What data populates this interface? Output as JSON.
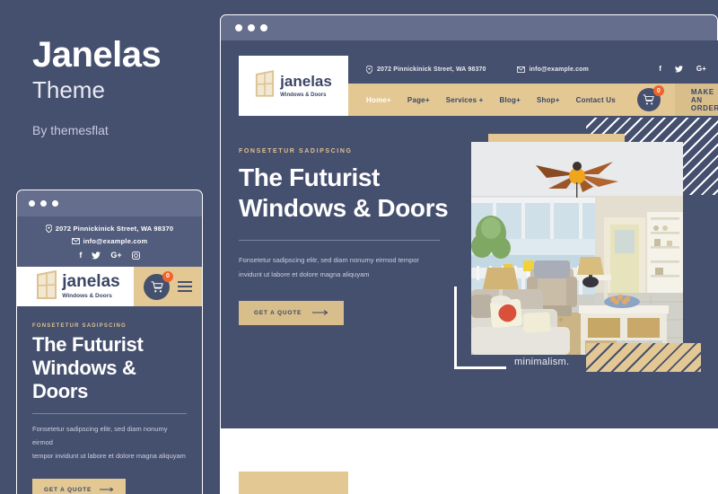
{
  "theme": {
    "name": "Janelas",
    "kind": "Theme",
    "author": "By themesflat",
    "colors": {
      "background": "#454f6e",
      "accent_tan": "#e3c894",
      "chrome": "#656e8c",
      "badge_orange": "#f0632a",
      "text_light": "#ccd1e0"
    }
  },
  "chrome": {
    "dots": [
      "red",
      "yellow",
      "green"
    ]
  },
  "site": {
    "logo": {
      "name": "janelas",
      "tagline": "Windows & Doors",
      "icon": "open-door-window-icon"
    },
    "topbar": {
      "address": "2072 Pinnickinick Street, WA 98370",
      "address_icon": "location-pin-icon",
      "email": "info@example.com",
      "email_icon": "envelope-icon",
      "social": [
        {
          "name": "facebook-icon",
          "glyph": "f"
        },
        {
          "name": "twitter-icon",
          "glyph": "ᵛ"
        },
        {
          "name": "google-plus-icon",
          "glyph": "G+"
        },
        {
          "name": "instagram-icon",
          "glyph": "□"
        }
      ]
    },
    "nav": {
      "items": [
        {
          "label": "Home+",
          "active": true
        },
        {
          "label": "Page+",
          "active": false
        },
        {
          "label": "Services +",
          "active": false
        },
        {
          "label": "Blog+",
          "active": false
        },
        {
          "label": "Shop+",
          "active": false
        },
        {
          "label": "Contact Us",
          "active": false
        }
      ],
      "cart": {
        "icon": "shopping-cart-icon",
        "count": "0"
      },
      "order_button": {
        "label": "MAKE AN ORDER",
        "icon": "arrow-right-icon"
      },
      "menu_toggle": "hamburger-menu-icon"
    },
    "hero": {
      "eyebrow": "FONSETETUR SADIPSCING",
      "heading_line1": "The Futurist",
      "heading_line2": "Windows & Doors",
      "description_desktop_line1": "Fonsetetur sadipscing elitr, sed diam nonumy eirmod tempor",
      "description_desktop_line2": "invidunt ut labore et dolore magna aliquyam",
      "description_mobile_line1": "Fonsetetur sadipscing elitr, sed diam nonumy eirmod",
      "description_mobile_line2": "tempor invidunt ut labore et dolore magna aliquyam",
      "cta": {
        "label": "GET A QUOTE",
        "icon": "arrow-right-icon"
      },
      "image_caption": "minimalism.",
      "image_alt": "living-room-interior-photo"
    }
  }
}
